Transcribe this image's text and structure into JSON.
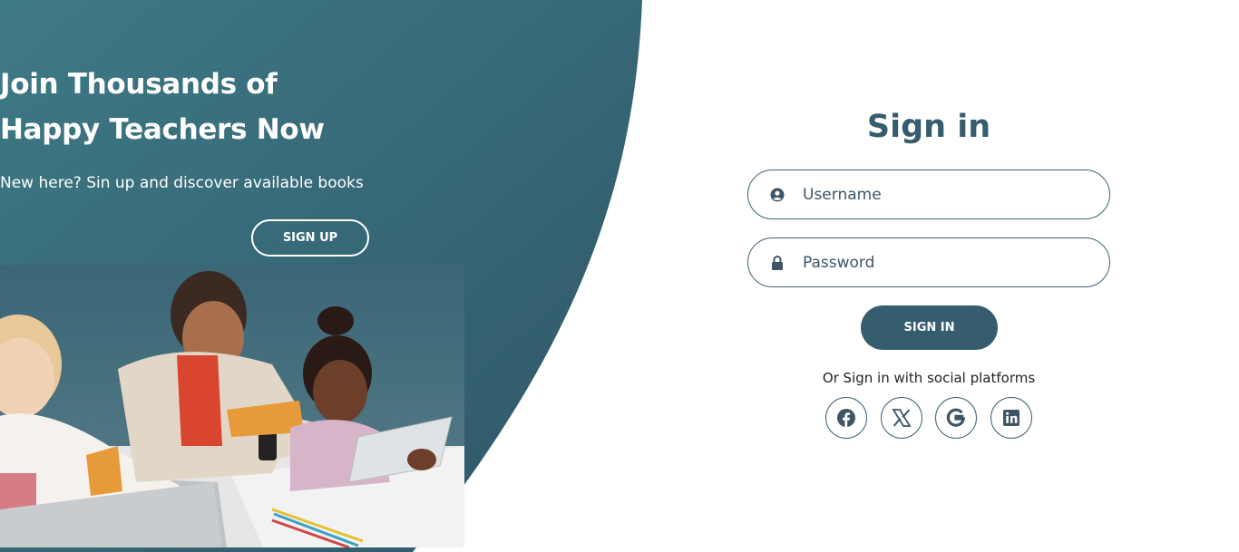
{
  "colors": {
    "primary": "#365d6e",
    "panel_gradient_start": "#3e7a86",
    "panel_gradient_end": "#2f5566",
    "white": "#ffffff"
  },
  "left_panel": {
    "headline_line1": "Join Thousands of",
    "headline_line2": "Happy Teachers Now",
    "subtext": "New here? Sin up and discover available books",
    "signup_label": "SIGN UP"
  },
  "signin": {
    "title": "Sign in",
    "username_placeholder": "Username",
    "password_placeholder": "Password",
    "button_label": "SIGN IN",
    "social_text": "Or Sign in with social platforms",
    "social_icons": [
      "facebook-icon",
      "x-icon",
      "google-icon",
      "linkedin-icon"
    ]
  }
}
